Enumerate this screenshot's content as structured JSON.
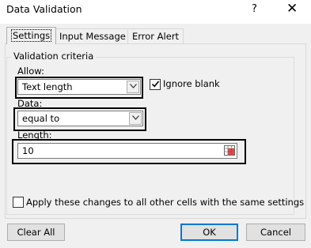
{
  "window": {
    "title": "Data Validation",
    "help_glyph": "?",
    "close_glyph": "✕"
  },
  "tabs": [
    {
      "label": "Settings",
      "active": true
    },
    {
      "label": "Input Message",
      "active": false
    },
    {
      "label": "Error Alert",
      "active": false
    }
  ],
  "validation": {
    "group_title": "Validation criteria",
    "allow_label": "Allow:",
    "allow_value": "Text length",
    "ignore_blank_label": "Ignore blank",
    "ignore_blank_checked": true,
    "data_label": "Data:",
    "data_value": "equal to",
    "length_label": "Length:",
    "length_value": "10"
  },
  "apply_label": "Apply these changes to all other cells with the same settings",
  "apply_checked": false,
  "buttons": {
    "clear_all": "Clear All",
    "ok": "OK",
    "cancel": "Cancel"
  },
  "icons": {
    "dropdown": "chevron-down-icon",
    "range_select": "range-select-icon",
    "check": "checkmark-icon"
  },
  "colors": {
    "dialog_bg": "#f0f0f0",
    "accent": "#0078d7"
  }
}
